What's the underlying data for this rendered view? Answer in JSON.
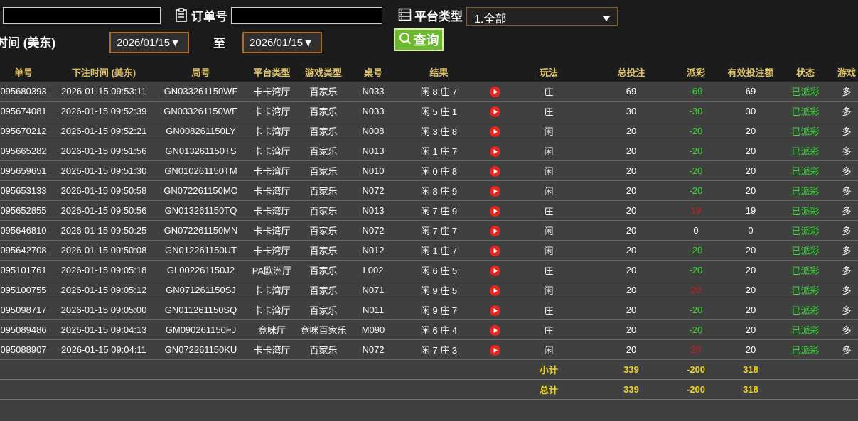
{
  "filters": {
    "order_label": "订单号",
    "platform_label": "平台类型",
    "platform_selected": "1.全部",
    "time_label": "时间 (美东)",
    "date_from": "2026/01/15▼",
    "to_label": "至",
    "date_to": "2026/01/15▼",
    "query_label": "查询"
  },
  "table": {
    "headers": [
      "单号",
      "下注时间 (美东)",
      "局号",
      "平台类型",
      "游戏类型",
      "桌号",
      "结果",
      "",
      "玩法",
      "总投注",
      "派彩",
      "有效投注额",
      "状态",
      "游戏"
    ],
    "rows": [
      [
        "095680393",
        "2026-01-15 09:53:11",
        "GN033261150WF",
        "卡卡湾厅",
        "百家乐",
        "N033",
        "闲 8 庄 7",
        "庄",
        "69",
        "-69",
        "69",
        "已派彩",
        "多"
      ],
      [
        "095674081",
        "2026-01-15 09:52:39",
        "GN033261150WE",
        "卡卡湾厅",
        "百家乐",
        "N033",
        "闲 5 庄 1",
        "庄",
        "30",
        "-30",
        "30",
        "已派彩",
        "多"
      ],
      [
        "095670212",
        "2026-01-15 09:52:21",
        "GN008261150LY",
        "卡卡湾厅",
        "百家乐",
        "N008",
        "闲 3 庄 8",
        "闲",
        "20",
        "-20",
        "20",
        "已派彩",
        "多"
      ],
      [
        "095665282",
        "2026-01-15 09:51:56",
        "GN013261150TS",
        "卡卡湾厅",
        "百家乐",
        "N013",
        "闲 1 庄 7",
        "闲",
        "20",
        "-20",
        "20",
        "已派彩",
        "多"
      ],
      [
        "095659651",
        "2026-01-15 09:51:30",
        "GN010261150TM",
        "卡卡湾厅",
        "百家乐",
        "N010",
        "闲 0 庄 8",
        "闲",
        "20",
        "-20",
        "20",
        "已派彩",
        "多"
      ],
      [
        "095653133",
        "2026-01-15 09:50:58",
        "GN072261150MO",
        "卡卡湾厅",
        "百家乐",
        "N072",
        "闲 8 庄 9",
        "闲",
        "20",
        "-20",
        "20",
        "已派彩",
        "多"
      ],
      [
        "095652855",
        "2026-01-15 09:50:56",
        "GN013261150TQ",
        "卡卡湾厅",
        "百家乐",
        "N013",
        "闲 7 庄 9",
        "庄",
        "20",
        "19",
        "19",
        "已派彩",
        "多"
      ],
      [
        "095646810",
        "2026-01-15 09:50:25",
        "GN072261150MN",
        "卡卡湾厅",
        "百家乐",
        "N072",
        "闲 7 庄 7",
        "闲",
        "20",
        "0",
        "0",
        "已派彩",
        "多"
      ],
      [
        "095642708",
        "2026-01-15 09:50:08",
        "GN012261150UT",
        "卡卡湾厅",
        "百家乐",
        "N012",
        "闲 1 庄 7",
        "闲",
        "20",
        "-20",
        "20",
        "已派彩",
        "多"
      ],
      [
        "095101761",
        "2026-01-15 09:05:18",
        "GL002261150J2",
        "PA欧洲厅",
        "百家乐",
        "L002",
        "闲 6 庄 5",
        "庄",
        "20",
        "-20",
        "20",
        "已派彩",
        "多"
      ],
      [
        "095100755",
        "2026-01-15 09:05:12",
        "GN071261150SJ",
        "卡卡湾厅",
        "百家乐",
        "N071",
        "闲 9 庄 5",
        "闲",
        "20",
        "20",
        "20",
        "已派彩",
        "多"
      ],
      [
        "095098717",
        "2026-01-15 09:05:00",
        "GN011261150SQ",
        "卡卡湾厅",
        "百家乐",
        "N011",
        "闲 9 庄 7",
        "庄",
        "20",
        "-20",
        "20",
        "已派彩",
        "多"
      ],
      [
        "095089486",
        "2026-01-15 09:04:13",
        "GM090261150FJ",
        "竞咪厅",
        "竞咪百家乐",
        "M090",
        "闲 6 庄 4",
        "庄",
        "20",
        "-20",
        "20",
        "已派彩",
        "多"
      ],
      [
        "095088907",
        "2026-01-15 09:04:11",
        "GN072261150KU",
        "卡卡湾厅",
        "百家乐",
        "N072",
        "闲 7 庄 3",
        "闲",
        "20",
        "20",
        "20",
        "已派彩",
        "多"
      ]
    ],
    "subtotal": {
      "label": "小计",
      "bet": "339",
      "payout": "-200",
      "valid": "318"
    },
    "total": {
      "label": "总计",
      "bet": "339",
      "payout": "-200",
      "valid": "318"
    }
  },
  "colors": {
    "header_text": "#e2c56a",
    "negative_payout": "#2ee02e",
    "positive_payout": "#d21a1a",
    "status_paid": "#2ee02e",
    "total_text": "#f1d21f",
    "play_icon": "#e8261c"
  },
  "icons": {
    "order": "clipboard-icon",
    "platform": "list-icon",
    "query": "search-icon",
    "result_video": "play-icon"
  }
}
